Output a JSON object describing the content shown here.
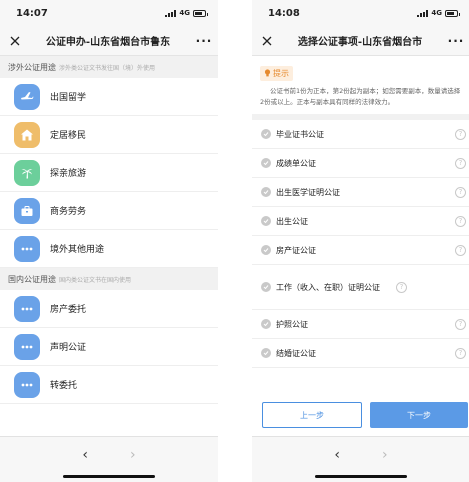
{
  "left": {
    "time": "14:07",
    "network": "4G",
    "title": "公证申办-山东省烟台市鲁东",
    "sections": [
      {
        "title": "涉外公证用途",
        "subtitle": "涉外类公证文书发往国（境）外使用",
        "items": [
          {
            "label": "出国留学",
            "icon": "airplane-icon",
            "color": "#6aa2e8"
          },
          {
            "label": "定居移民",
            "icon": "house-icon",
            "color": "#efbd6a"
          },
          {
            "label": "探亲旅游",
            "icon": "palm-tree-icon",
            "color": "#6ccf9b"
          },
          {
            "label": "商务劳务",
            "icon": "briefcase-icon",
            "color": "#6aa2e8"
          },
          {
            "label": "境外其他用途",
            "icon": "more-dots-icon",
            "color": "#6aa2e8"
          }
        ]
      },
      {
        "title": "国内公证用途",
        "subtitle": "国内类公证文书在国内使用",
        "items": [
          {
            "label": "房产委托",
            "icon": "more-dots-icon",
            "color": "#6aa2e8"
          },
          {
            "label": "声明公证",
            "icon": "more-dots-icon",
            "color": "#6aa2e8"
          },
          {
            "label": "转委托",
            "icon": "more-dots-icon",
            "color": "#6aa2e8"
          }
        ]
      }
    ]
  },
  "right": {
    "time": "14:08",
    "network": "4G",
    "title": "选择公证事项-山东省烟台市",
    "tip_label": "提示",
    "tip_text": "公证书前1份为正本，第2份起为副本；如您需要副本，数量请选择2份或以上。正本与副本具有同样的法律效力。",
    "matters": [
      {
        "label": "毕业证书公证"
      },
      {
        "label": "成绩单公证"
      },
      {
        "label": "出生医学证明公证"
      },
      {
        "label": "出生公证"
      },
      {
        "label": "房产证公证"
      },
      {
        "label": "工作（收入、在职）证明公证"
      },
      {
        "label": "护照公证"
      },
      {
        "label": "结婚证公证"
      }
    ],
    "prev_label": "上一步",
    "next_label": "下一步"
  }
}
